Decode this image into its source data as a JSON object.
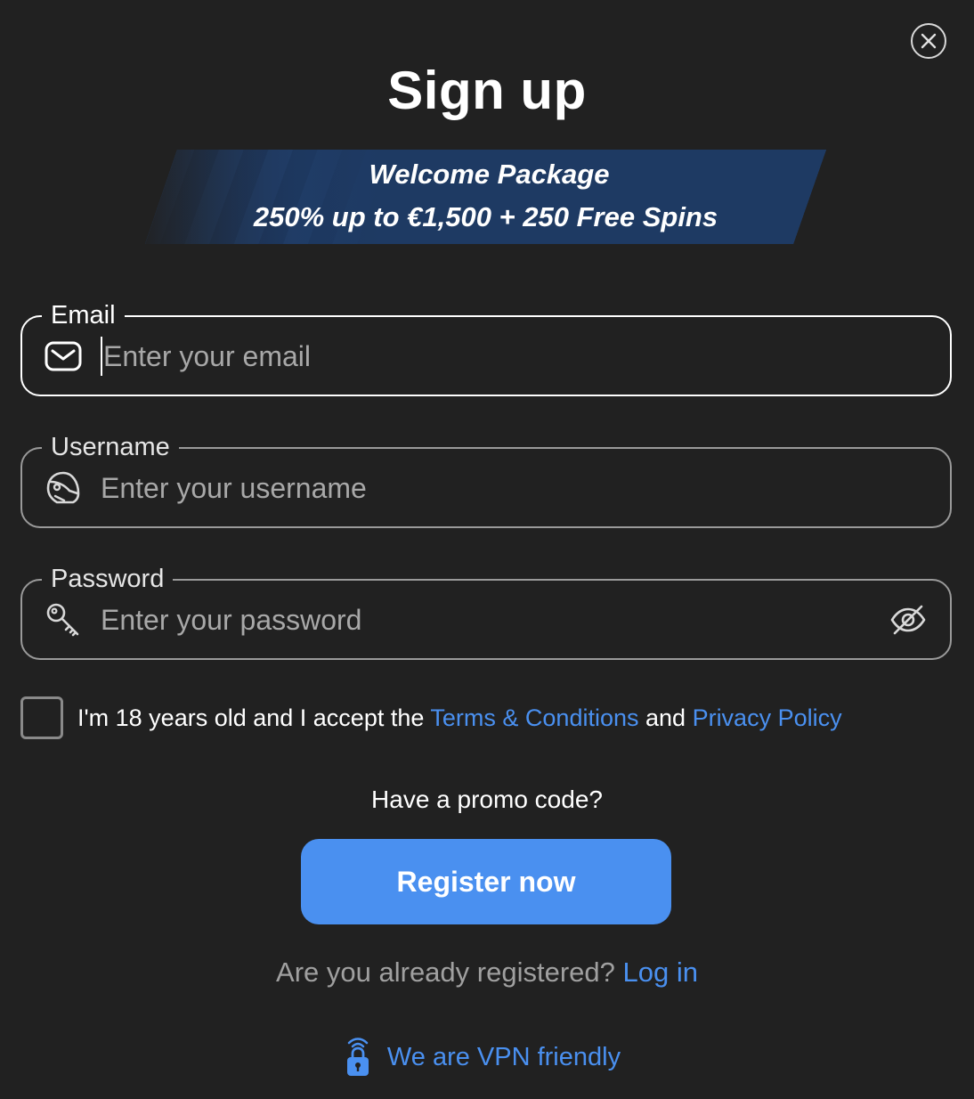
{
  "modal": {
    "title": "Sign up",
    "close_icon": "close-icon"
  },
  "banner": {
    "line1": "Welcome Package",
    "line2": "250% up to €1,500 + 250 Free Spins"
  },
  "form": {
    "email": {
      "label": "Email",
      "placeholder": "Enter your email",
      "value": "",
      "icon": "envelope-icon"
    },
    "username": {
      "label": "Username",
      "placeholder": "Enter your username",
      "value": "",
      "icon": "helmet-icon"
    },
    "password": {
      "label": "Password",
      "placeholder": "Enter your password",
      "value": "",
      "icon": "key-icon",
      "toggle_icon": "eye-off-icon"
    },
    "terms": {
      "checked": false,
      "prefix": "I'm 18 years old and I accept the ",
      "terms_link": "Terms & Conditions",
      "middle": " and ",
      "privacy_link": "Privacy Policy"
    },
    "promo_label": "Have a promo code?",
    "submit_label": "Register now"
  },
  "footer": {
    "login_prompt": "Are you already registered? ",
    "login_link": "Log in",
    "vpn_text": "We are VPN friendly",
    "vpn_icon": "lock-wifi-icon"
  },
  "colors": {
    "background": "#212121",
    "accent": "#4a90f0",
    "banner": "#1e3a63"
  }
}
